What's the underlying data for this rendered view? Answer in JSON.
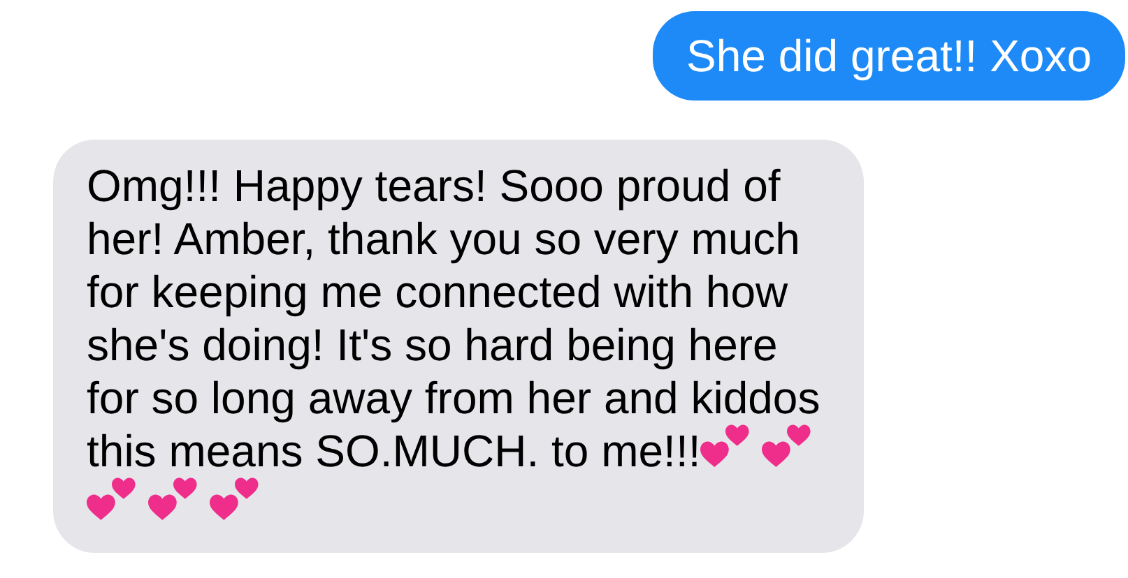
{
  "messages": [
    {
      "kind": "sent",
      "text": "She did great!! Xoxo"
    },
    {
      "kind": "received",
      "text": "Omg!!! Happy tears! Sooo proud of\nher! Amber, thank you so very much\nfor keeping me connected with how\nshe's doing! It's so hard being here\nfor so long away from her and kiddos",
      "last_line": "this means SO.MUCH. to me!!!",
      "trailing_icons": [
        {
          "kind": "two-hearts"
        },
        {
          "kind": "two-hearts"
        },
        {
          "kind": "two-hearts"
        },
        {
          "kind": "two-hearts"
        },
        {
          "kind": "two-hearts"
        }
      ]
    }
  ]
}
